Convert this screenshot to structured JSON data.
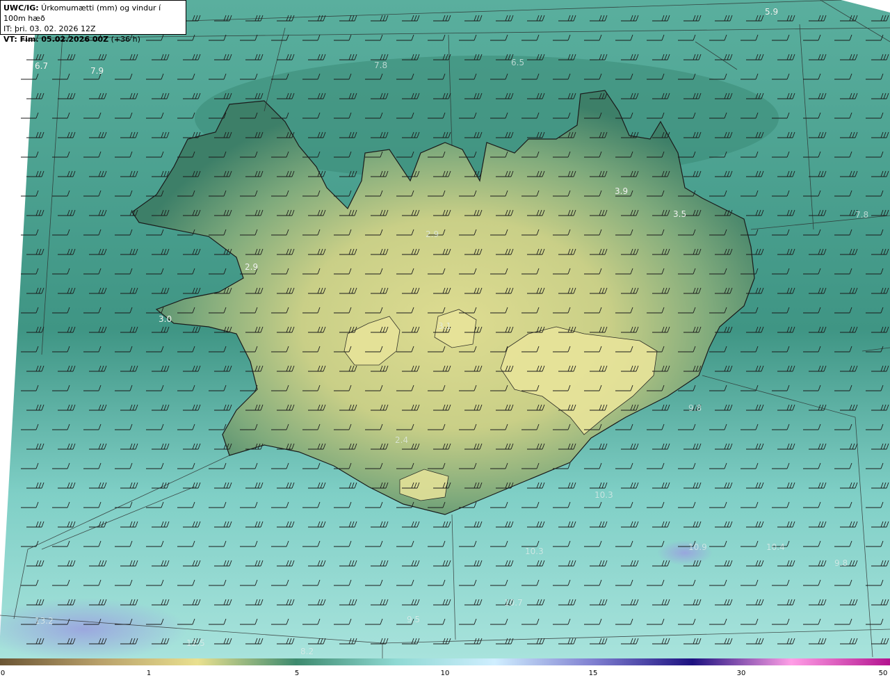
{
  "header": {
    "product": "UWC/IG:",
    "title": " Úrkomumætti (mm) og vindur í 100m hæð",
    "issue_time": "IT: þri. 03. 02. 2026 12Z",
    "valid_time_prefix": "VT: Fim. 05.02.2026 00Z",
    "valid_time_suffix": " (+36 h)"
  },
  "value_labels": [
    {
      "text": "5.9"
    },
    {
      "text": "6.7"
    },
    {
      "text": "7.9"
    },
    {
      "text": "7.8"
    },
    {
      "text": "6.5"
    },
    {
      "text": "3.9"
    },
    {
      "text": "3.5"
    },
    {
      "text": "7.8"
    },
    {
      "text": "2.9"
    },
    {
      "text": "3.0"
    },
    {
      "text": "2.9"
    },
    {
      "text": "3.1"
    },
    {
      "text": "9.8"
    },
    {
      "text": "2.4"
    },
    {
      "text": "10.3"
    },
    {
      "text": "10.3"
    },
    {
      "text": "10.9"
    },
    {
      "text": "10.4"
    },
    {
      "text": "9.8"
    },
    {
      "text": "10.7"
    },
    {
      "text": "9.5"
    },
    {
      "text": "8.2"
    },
    {
      "text": "13.2"
    },
    {
      "text": "12.5"
    }
  ],
  "colorbar": {
    "ticks": [
      "0",
      "1",
      "5",
      "10",
      "15",
      "30",
      "50"
    ],
    "colors": [
      "#6b5534",
      "#b8a06a",
      "#e9e08f",
      "#3d8a6e",
      "#8fd9d3",
      "#cfeeff",
      "#7f7fd0",
      "#1d1180",
      "#ff9ee6",
      "#b4138f"
    ]
  },
  "map_colors": {
    "sea_outer": "#5fb0a3",
    "sea_south": "#9fdcd5",
    "land_low": "#3f8670",
    "land_high": "#d8d88e"
  }
}
